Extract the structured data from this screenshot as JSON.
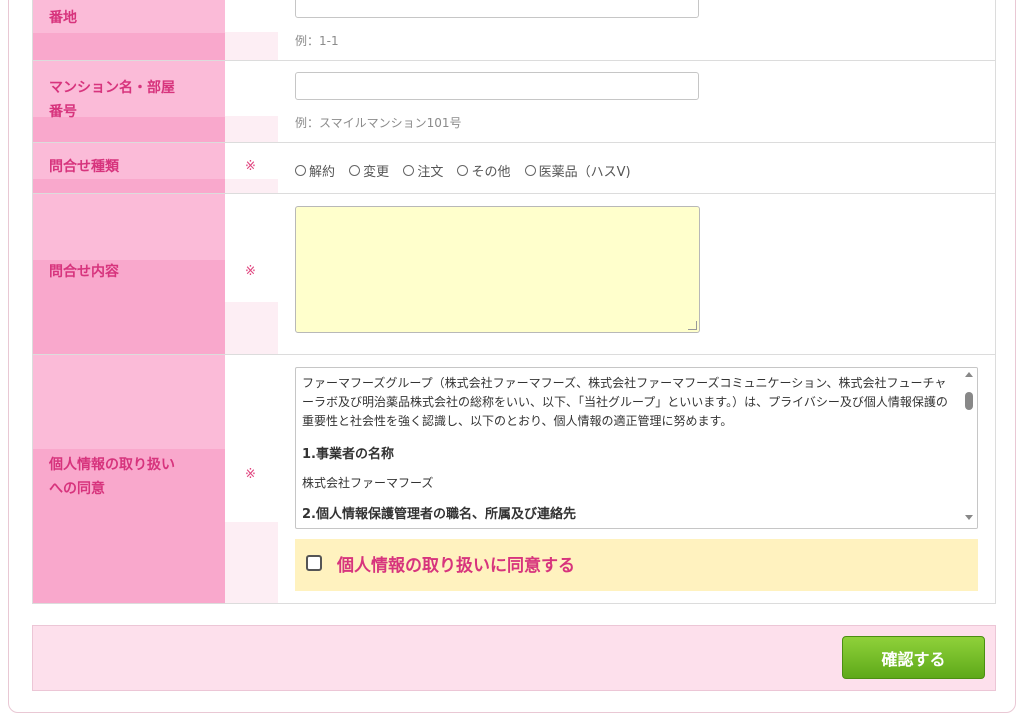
{
  "form": {
    "rows": {
      "banchi": {
        "label": "番地",
        "example": "例：1-1"
      },
      "mansion": {
        "label_line1": "マンション名・部屋",
        "label_line2": "番号",
        "example": "例：スマイルマンション101号"
      },
      "inquiry_type": {
        "label": "問合せ種類",
        "required_mark": "※",
        "options": [
          "解約",
          "変更",
          "注文",
          "その他",
          "医薬品（ハスV)"
        ]
      },
      "inquiry_content": {
        "label": "問合せ内容",
        "required_mark": "※"
      },
      "privacy": {
        "label_line1": "個人情報の取り扱い",
        "label_line2": "への同意",
        "required_mark": "※",
        "policy_intro": "ファーマフーズグループ（株式会社ファーマフーズ、株式会社ファーマフーズコミュニケーション、株式会社フューチャーラボ及び明治薬品株式会社の総称をいい、以下、「当社グループ」といいます。）は、プライバシー及び個人情報保護の重要性と社会性を強く認識し、以下のとおり、個人情報の適正管理に努めます。",
        "policy_heading1": "1.事業者の名称",
        "policy_company": "株式会社ファーマフーズ",
        "policy_heading2_partial": "2.個人情報保護管理者の職名、所属及び連絡先",
        "consent_label": "個人情報の取り扱いに同意する",
        "consent_checked": false
      }
    }
  },
  "footer": {
    "confirm_label": "確認する"
  },
  "colors": {
    "label_bg": "#f9a8cc",
    "label_text": "#d7347d",
    "textarea_bg": "#ffffcc",
    "consent_bg": "#fff2bf",
    "footer_bg": "#fde0ec",
    "button_green": "#6fbc22"
  },
  "icons": {
    "scroll_up": "scroll-up-arrow-icon",
    "scroll_down": "scroll-down-arrow-icon",
    "radio": "radio-circle-icon",
    "checkbox": "checkbox-icon"
  }
}
